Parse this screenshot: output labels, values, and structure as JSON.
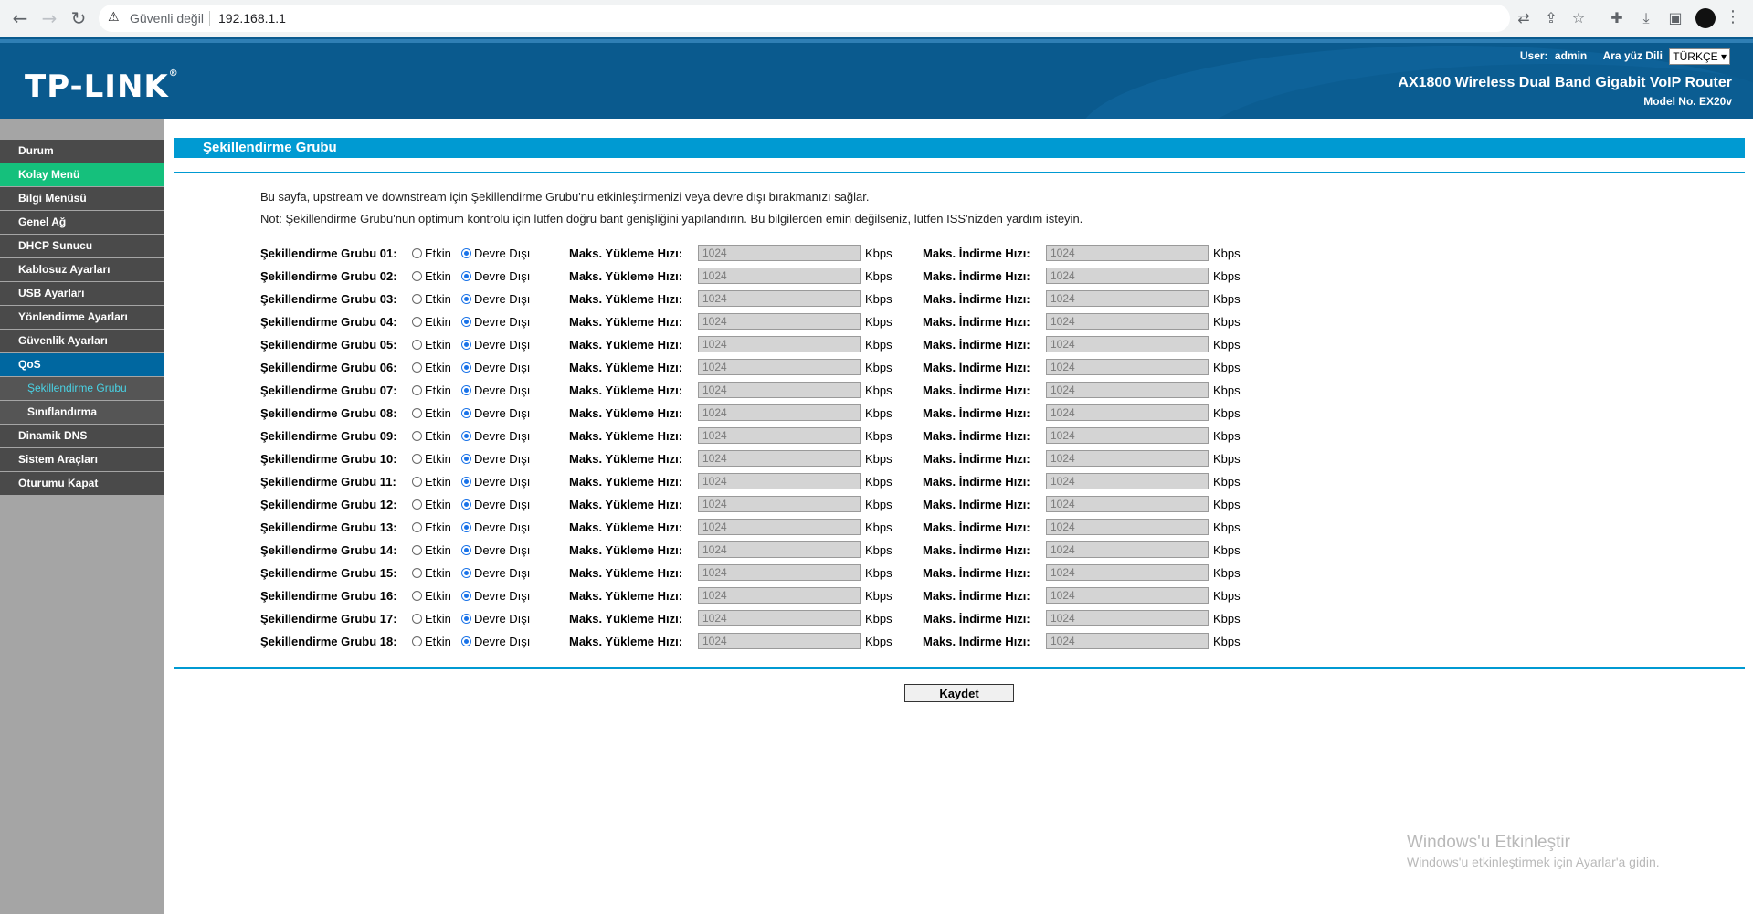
{
  "browser": {
    "security_text": "Güvenli değil",
    "url": "192.168.1.1",
    "icons": [
      "back-icon",
      "forward-icon",
      "reload-icon",
      "warning-icon",
      "translate-icon",
      "share-icon",
      "star-icon",
      "extensions-icon",
      "download-icon",
      "sidepanel-icon",
      "profile-avatar",
      "menu-kebab-icon"
    ]
  },
  "header": {
    "logo": "TP-LINK",
    "user_label": "User:",
    "user_value": "admin",
    "lang_label": "Ara yüz Dili",
    "lang_value": "TÜRKÇE ▾",
    "product": "AX1800 Wireless Dual Band Gigabit VoIP Router",
    "model": "Model No. EX20v"
  },
  "sidebar": {
    "items": [
      {
        "label": "Durum"
      },
      {
        "label": "Kolay Menü"
      },
      {
        "label": "Bilgi Menüsü"
      },
      {
        "label": "Genel Ağ"
      },
      {
        "label": "DHCP Sunucu"
      },
      {
        "label": "Kablosuz Ayarları"
      },
      {
        "label": "USB Ayarları"
      },
      {
        "label": "Yönlendirme Ayarları"
      },
      {
        "label": "Güvenlik Ayarları"
      },
      {
        "label": "QoS"
      },
      {
        "label": "Şekillendirme Grubu"
      },
      {
        "label": "Sınıflandırma"
      },
      {
        "label": "Dinamik DNS"
      },
      {
        "label": "Sistem Araçları"
      },
      {
        "label": "Oturumu Kapat"
      }
    ]
  },
  "page": {
    "title": "Şekillendirme Grubu",
    "desc1": "Bu sayfa, upstream ve downstream için Şekillendirme Grubu'nu etkinleştirmenizi veya devre dışı bırakmanızı sağlar.",
    "desc2": "Not: Şekillendirme Grubu'nun optimum kontrolü için lütfen doğru bant genişliğini yapılandırın. Bu bilgilerden emin değilseniz, lütfen ISS'nizden yardım isteyin.",
    "enable_label": "Etkin",
    "disable_label": "Devre Dışı",
    "upload_label": "Maks. Yükleme Hızı:",
    "download_label": "Maks. İndirme Hızı:",
    "unit": "Kbps",
    "save_label": "Kaydet"
  },
  "groups": [
    {
      "label": "Şekillendirme Grubu 01:",
      "upload": "1024",
      "download": "1024",
      "enabled": false
    },
    {
      "label": "Şekillendirme Grubu 02:",
      "upload": "1024",
      "download": "1024",
      "enabled": false
    },
    {
      "label": "Şekillendirme Grubu 03:",
      "upload": "1024",
      "download": "1024",
      "enabled": false
    },
    {
      "label": "Şekillendirme Grubu 04:",
      "upload": "1024",
      "download": "1024",
      "enabled": false
    },
    {
      "label": "Şekillendirme Grubu 05:",
      "upload": "1024",
      "download": "1024",
      "enabled": false
    },
    {
      "label": "Şekillendirme Grubu 06:",
      "upload": "1024",
      "download": "1024",
      "enabled": false
    },
    {
      "label": "Şekillendirme Grubu 07:",
      "upload": "1024",
      "download": "1024",
      "enabled": false
    },
    {
      "label": "Şekillendirme Grubu 08:",
      "upload": "1024",
      "download": "1024",
      "enabled": false
    },
    {
      "label": "Şekillendirme Grubu 09:",
      "upload": "1024",
      "download": "1024",
      "enabled": false
    },
    {
      "label": "Şekillendirme Grubu 10:",
      "upload": "1024",
      "download": "1024",
      "enabled": false
    },
    {
      "label": "Şekillendirme Grubu 11:",
      "upload": "1024",
      "download": "1024",
      "enabled": false
    },
    {
      "label": "Şekillendirme Grubu 12:",
      "upload": "1024",
      "download": "1024",
      "enabled": false
    },
    {
      "label": "Şekillendirme Grubu 13:",
      "upload": "1024",
      "download": "1024",
      "enabled": false
    },
    {
      "label": "Şekillendirme Grubu 14:",
      "upload": "1024",
      "download": "1024",
      "enabled": false
    },
    {
      "label": "Şekillendirme Grubu 15:",
      "upload": "1024",
      "download": "1024",
      "enabled": false
    },
    {
      "label": "Şekillendirme Grubu 16:",
      "upload": "1024",
      "download": "1024",
      "enabled": false
    },
    {
      "label": "Şekillendirme Grubu 17:",
      "upload": "1024",
      "download": "1024",
      "enabled": false
    },
    {
      "label": "Şekillendirme Grubu 18:",
      "upload": "1024",
      "download": "1024",
      "enabled": false
    }
  ],
  "windows_activation": {
    "title": "Windows'u Etkinleştir",
    "subtitle": "Windows'u etkinleştirmek için Ayarlar'a gidin."
  },
  "colors": {
    "header_blue": "#0a5a8e",
    "title_bar": "#009ad2",
    "menu_green": "#15c07c",
    "menu_active": "#0067a0",
    "menu_dark": "#4a4a4a"
  }
}
